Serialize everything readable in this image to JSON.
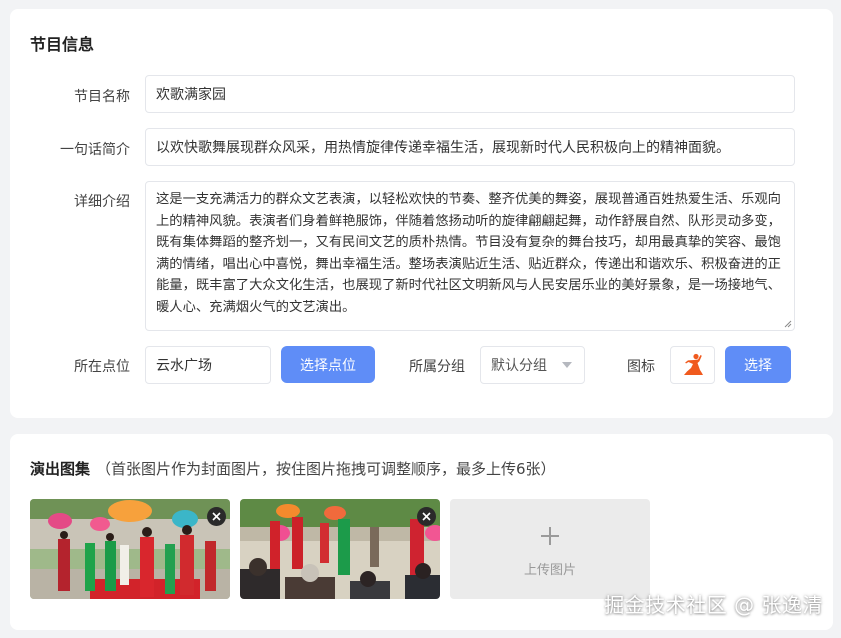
{
  "info": {
    "title": "节目信息",
    "name_label": "节目名称",
    "name_value": "欢歌满家园",
    "brief_label": "一句话简介",
    "brief_value": "以欢快歌舞展现群众风采，用热情旋律传递幸福生活，展现新时代人民积极向上的精神面貌。",
    "detail_label": "详细介绍",
    "detail_value": "这是一支充满活力的群众文艺表演，以轻松欢快的节奏、整齐优美的舞姿，展现普通百姓热爱生活、乐观向上的精神风貌。表演者们身着鲜艳服饰，伴随着悠扬动听的旋律翩翩起舞，动作舒展自然、队形灵动多变，既有集体舞蹈的整齐划一，又有民间文艺的质朴热情。节目没有复杂的舞台技巧，却用最真挚的笑容、最饱满的情绪，唱出心中喜悦，舞出幸福生活。整场表演贴近生活、贴近群众，传递出和谐欢乐、积极奋进的正能量，既丰富了大众文化生活，也展现了新时代社区文明新风与人民安居乐业的美好景象，是一场接地气、暖人心、充满烟火气的文艺演出。",
    "location_label": "所在点位",
    "location_value": "云水广场",
    "choose_location_btn": "选择点位",
    "group_label": "所属分组",
    "group_value": "默认分组",
    "icon_label": "图标",
    "icon_name": "dancer-icon",
    "choose_icon_btn": "选择"
  },
  "gallery": {
    "title": "演出图集",
    "hint": "（首张图片作为封面图片，按住图片拖拽可调整顺序，最多上传6张）",
    "photos": [
      {
        "name": "performance-photo-1"
      },
      {
        "name": "performance-photo-2"
      }
    ],
    "upload_label": "上传图片"
  },
  "watermark": "掘金技术社区 @ 张逸清",
  "colors": {
    "accent": "#5f8df7",
    "icon_orange": "#f05a1e",
    "background": "#f2f3f5"
  }
}
